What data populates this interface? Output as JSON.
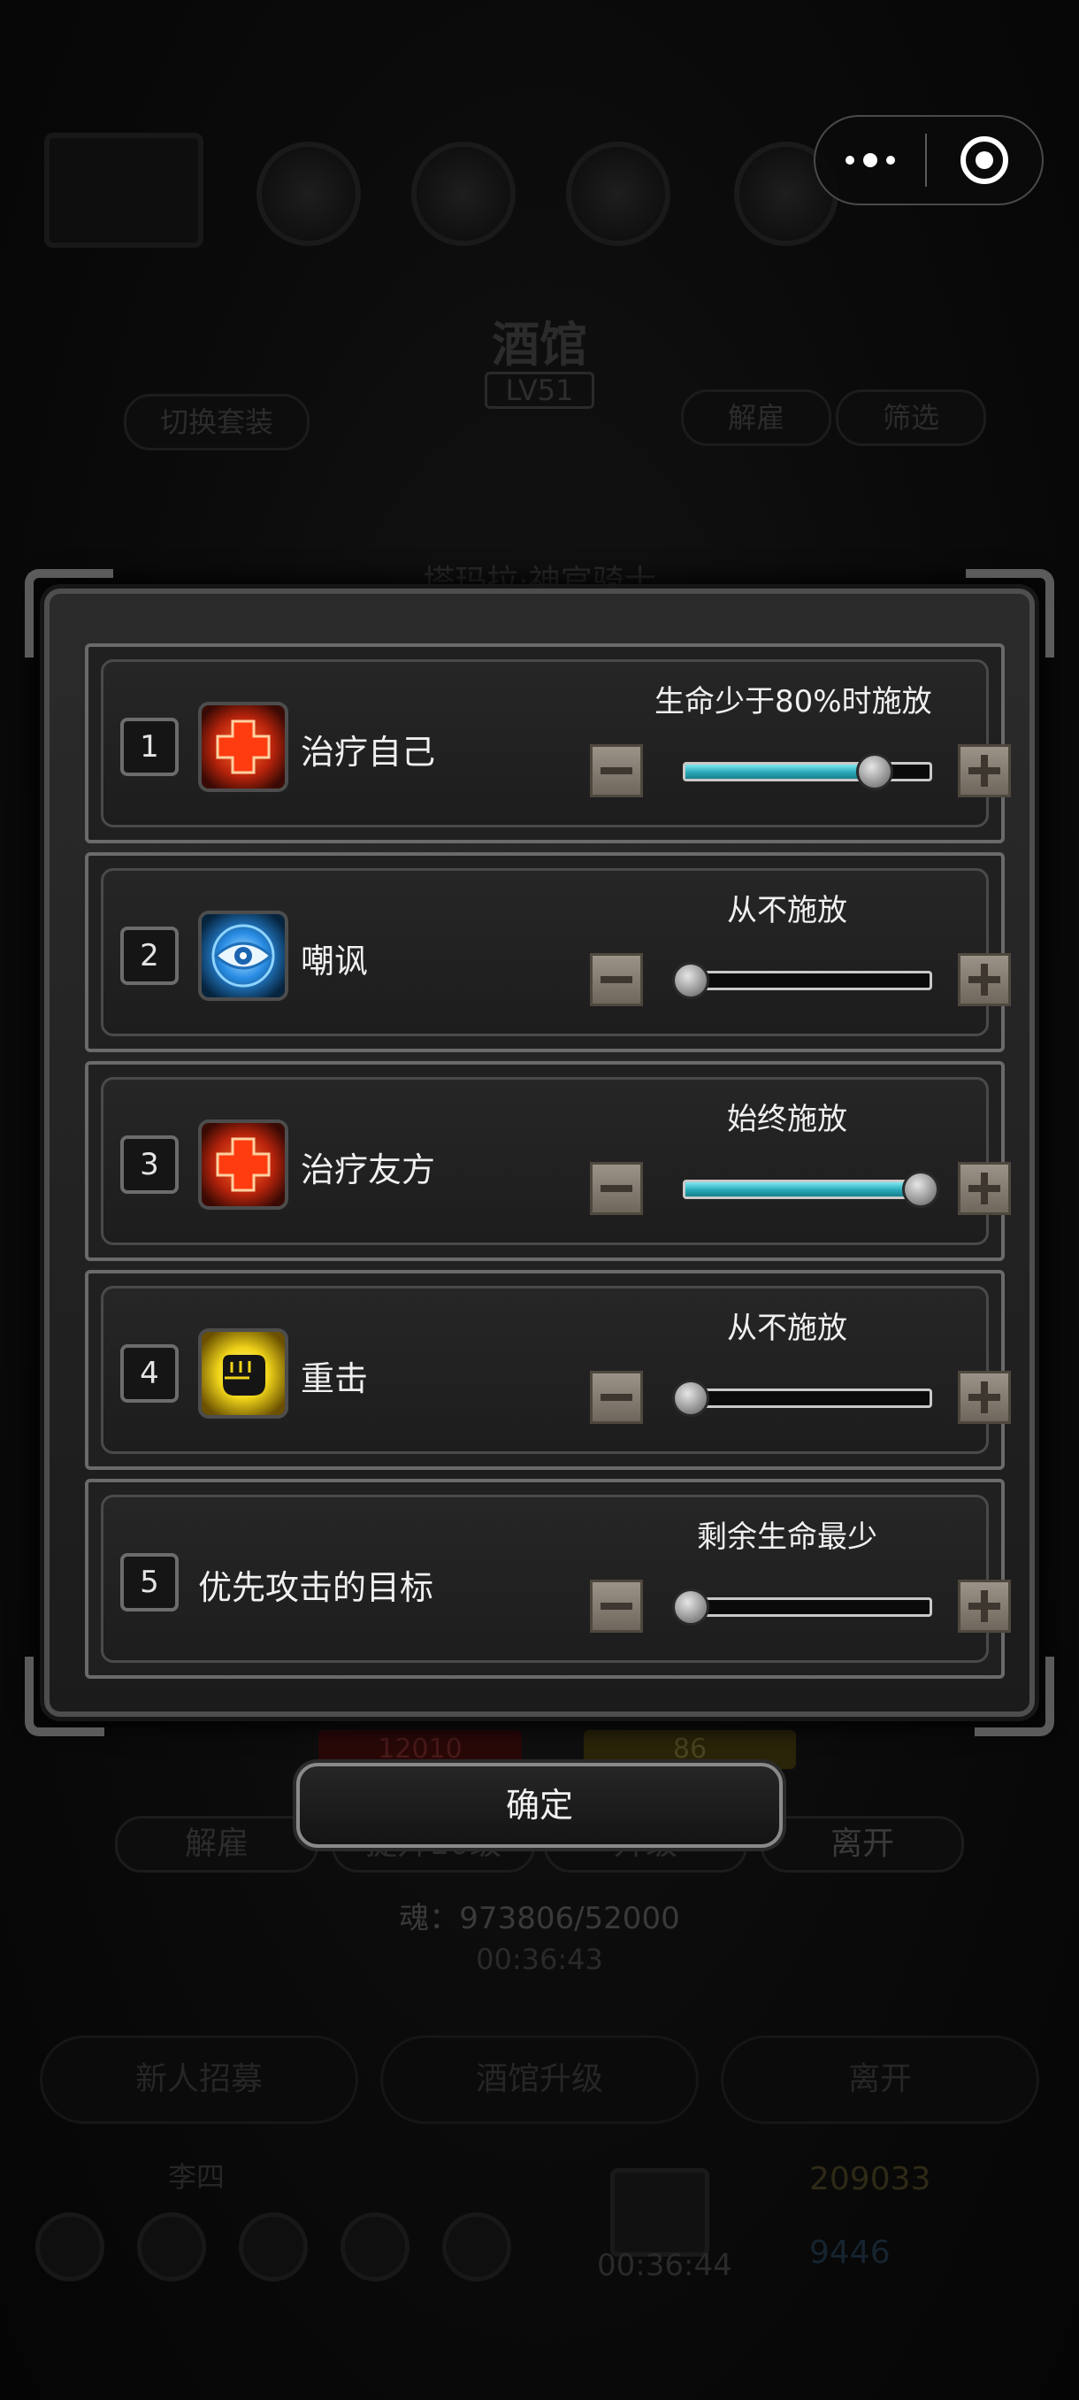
{
  "background": {
    "title": "酒馆",
    "level": "LV51",
    "left_tab": "切换套装",
    "right_tabs": [
      "解雇",
      "筛选"
    ],
    "character_name": "塔玛拉·神官骑士",
    "hp_value": "12010",
    "energy_value": "86",
    "action_buttons": [
      "解雇",
      "提升10级",
      "升级",
      "离开"
    ],
    "soul": "魂：973806/52000",
    "timer_top": "00:36:43",
    "bottom_buttons": [
      "新人招募",
      "酒馆升级",
      "离开"
    ],
    "player_name": "李四",
    "gold": "209033",
    "gems": "9446",
    "timer_bottom": "00:36:44"
  },
  "capsule": {
    "more_icon": "more-dots-icon",
    "close_icon": "target-close-icon"
  },
  "rows": [
    {
      "number": "1",
      "icon": "heal-cross-icon",
      "name": "治疗自己",
      "condition": "生命少于80%时施放",
      "level": 0.8
    },
    {
      "number": "2",
      "icon": "eye-taunt-icon",
      "name": "嘲讽",
      "condition": "从不施放",
      "level": 0
    },
    {
      "number": "3",
      "icon": "heal-cross-icon",
      "name": "治疗友方",
      "condition": "始终施放",
      "level": 1
    },
    {
      "number": "4",
      "icon": "fist-strike-icon",
      "name": "重击",
      "condition": "从不施放",
      "level": 0
    },
    {
      "number": "5",
      "icon": "",
      "name": "优先攻击的目标",
      "condition": "剩余生命最少",
      "level": 0
    }
  ],
  "confirm_label": "确定",
  "colors": {
    "slider_fill": "#2aa8b8",
    "heal_icon": "#e24a1a",
    "taunt_icon": "#2aa6ff",
    "fist_icon": "#f1d51a"
  }
}
